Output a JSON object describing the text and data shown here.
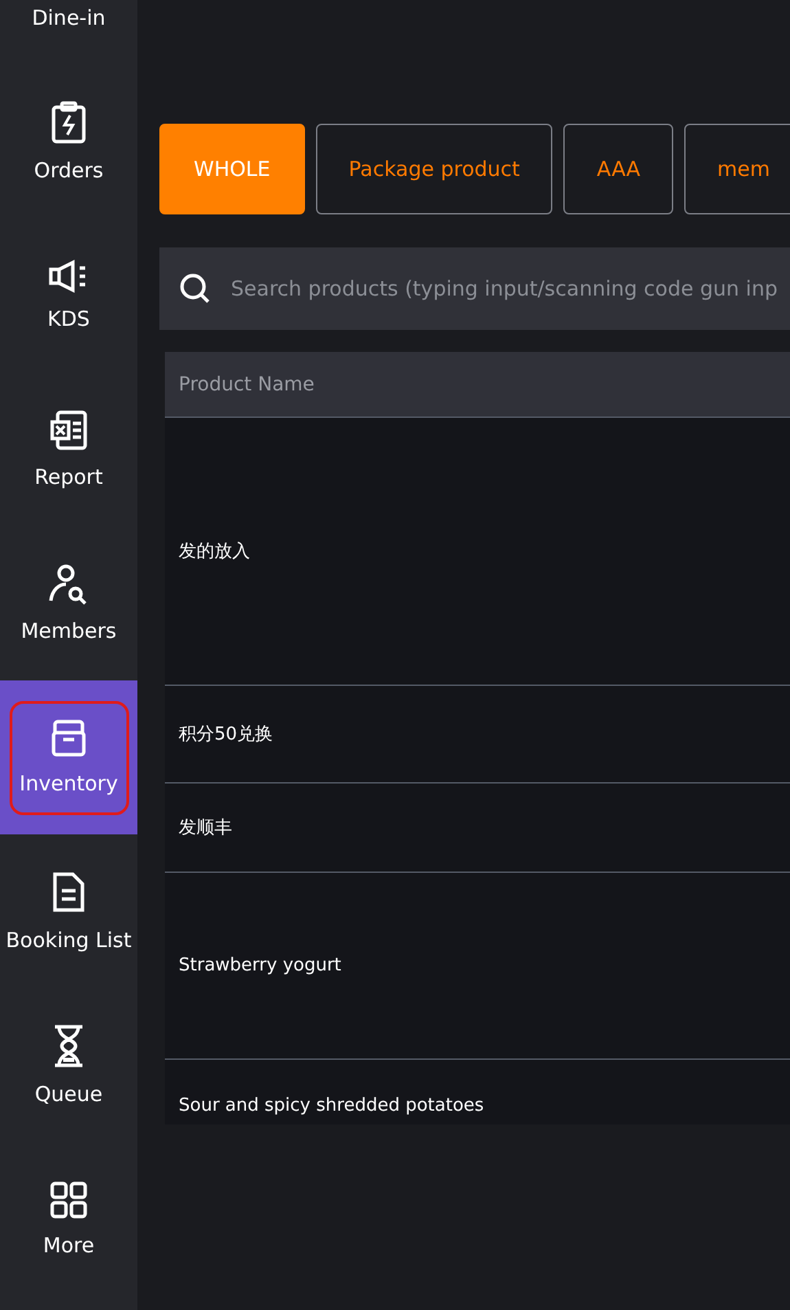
{
  "sidebar": {
    "items": [
      {
        "label": "Dine-in",
        "selected": false
      },
      {
        "label": "Orders",
        "selected": false
      },
      {
        "label": "KDS",
        "selected": false
      },
      {
        "label": "Report",
        "selected": false
      },
      {
        "label": "Members",
        "selected": false
      },
      {
        "label": "Inventory",
        "selected": true
      },
      {
        "label": "Booking List",
        "selected": false
      },
      {
        "label": "Queue",
        "selected": false
      },
      {
        "label": "More",
        "selected": false
      }
    ]
  },
  "tabs": [
    {
      "label": "WHOLE",
      "selected": true
    },
    {
      "label": "Package product",
      "selected": false
    },
    {
      "label": "AAA",
      "selected": false
    },
    {
      "label": "mem",
      "selected": false
    }
  ],
  "search": {
    "placeholder": "Search products (typing input/scanning code gun inp"
  },
  "table": {
    "columns": [
      "Product Name"
    ],
    "rows": [
      {
        "name": "发的放入"
      },
      {
        "name": "积分50兑换"
      },
      {
        "name": "发顺丰"
      },
      {
        "name": "Strawberry yogurt"
      },
      {
        "name": "Sour and spicy shredded potatoes"
      }
    ]
  }
}
